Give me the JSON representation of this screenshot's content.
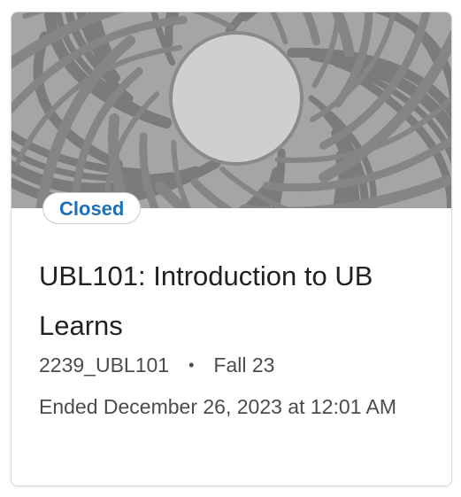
{
  "card": {
    "image_icon": "abstract-woven-pattern-image",
    "status_badge": "Closed",
    "title": "UBL101: Introduction to UB Learns",
    "course_code": "2239_UBL101",
    "separator": "•",
    "term": "Fall 23",
    "ended_text": "Ended December 26, 2023 at 12:01 AM"
  },
  "colors": {
    "badge_text": "#1d6fb8",
    "image_bg": "#9c9c9c",
    "image_lines": "#7a7a7a",
    "title_text": "#202122",
    "meta_text": "#494c4e"
  }
}
